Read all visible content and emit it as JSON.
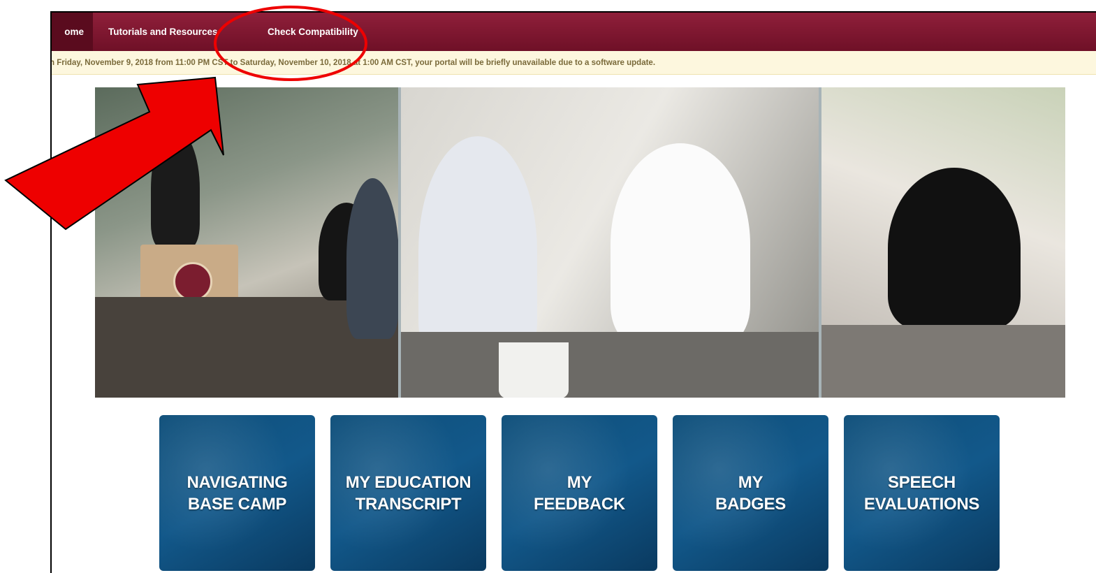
{
  "nav": {
    "home_label": "ome",
    "tutorials_label": "Tutorials and Resources",
    "compatibility_label": "Check Compatibility"
  },
  "banner": {
    "text": "n Friday, November 9, 2018 from 11:00 PM CST to Saturday, November 10, 2018 at 1:00 AM CST, your portal will be briefly unavailable due to a software update."
  },
  "tiles": [
    {
      "label": "NAVIGATING\nBASE CAMP"
    },
    {
      "label": "MY EDUCATION\nTRANSCRIPT"
    },
    {
      "label": "MY\nFEEDBACK"
    },
    {
      "label": "MY\nBADGES"
    },
    {
      "label": "SPEECH\nEVALUATIONS"
    }
  ],
  "colors": {
    "nav_background": "#7d1a33",
    "banner_background": "#fdf7de",
    "tile_background": "#0f4f7a",
    "annotation_red": "#ee0000"
  },
  "annotations": {
    "arrow": "red-arrow-icon",
    "circle": "red-circle-highlight"
  }
}
